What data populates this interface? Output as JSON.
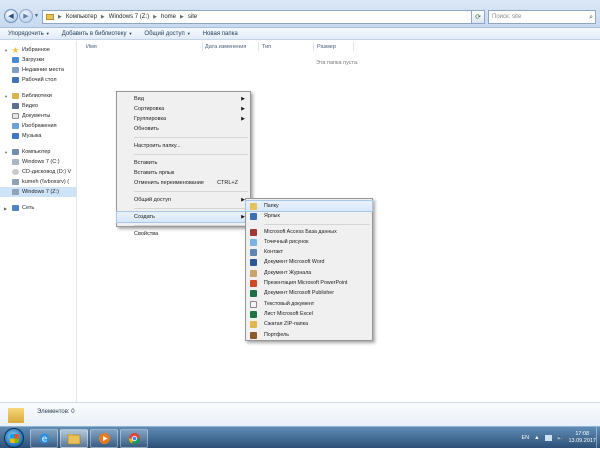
{
  "address": {
    "segments": [
      "Компьютер",
      "Windows 7 (Z:)",
      "home",
      "site"
    ],
    "search_placeholder": "Поиск: site"
  },
  "toolbar": {
    "organize": "Упорядочить",
    "add_to_library": "Добавить в библиотеку",
    "share": "Общий доступ",
    "new_folder": "Новая папка"
  },
  "sidebar": {
    "favorites": "Избранное",
    "downloads": "Загрузки",
    "recent": "Недавние места",
    "desktop": "Рабочий стол",
    "libraries": "Библиотеки",
    "video": "Видео",
    "documents": "Документы",
    "images": "Изображения",
    "music": "Музыка",
    "computer": "Компьютер",
    "drive_c": "Windows 7 (C:)",
    "drive_d": "CD-дисковод (D:) V",
    "drive_net": "kumeh (\\\\vboxsrv) (",
    "drive_z": "Windows 7 (Z:)",
    "network": "Сеть"
  },
  "columns": {
    "name": "Имя",
    "date": "Дата изменения",
    "type": "Тип",
    "size": "Размер"
  },
  "empty_text": "Эта папка пуста.",
  "context_menu": {
    "view": "Вид",
    "sort": "Сортировка",
    "group": "Группировка",
    "refresh": "Обновить",
    "customize": "Настроить папку...",
    "paste": "Вставить",
    "paste_shortcut": "Вставить ярлык",
    "undo_rename": "Отменить переименование",
    "undo_shortcut": "CTRL+Z",
    "sharing": "Общий доступ",
    "create": "Создать",
    "properties": "Свойства"
  },
  "submenu": {
    "folder": "Папку",
    "shortcut": "Ярлык",
    "access": "Microsoft Access База данных",
    "bitmap": "Точечный рисунок",
    "contact": "Контакт",
    "word": "Документ Microsoft Word",
    "journal": "Документ Журнала",
    "powerpoint": "Презентация Microsoft PowerPoint",
    "publisher": "Документ Microsoft Publisher",
    "text": "Текстовый документ",
    "excel": "Лист Microsoft Excel",
    "zip": "Сжатая ZIP-папка",
    "briefcase": "Портфель"
  },
  "status": {
    "items": "Элементов: 0"
  },
  "taskbar": {
    "lang": "EN",
    "time": "17:08",
    "date": "13.09.2017"
  },
  "colors": {
    "accent": "#cde3f8",
    "taskbar": "#2c5078",
    "folder": "#e8c15a"
  }
}
